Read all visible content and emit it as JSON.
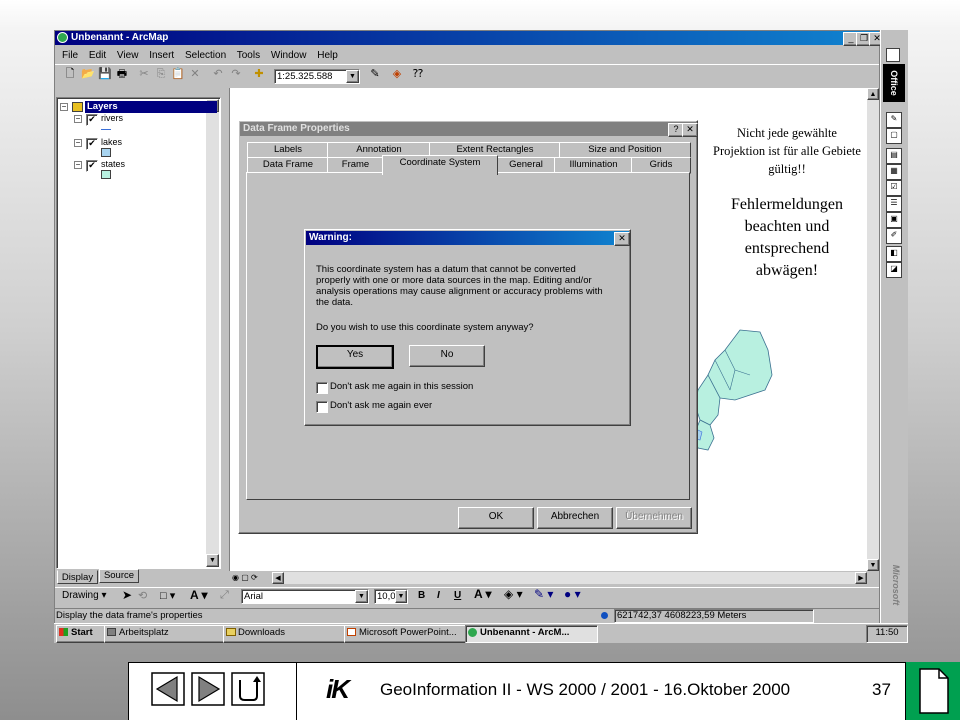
{
  "app": {
    "title": "Unbenannt - ArcMap",
    "menu": [
      "File",
      "Edit",
      "View",
      "Insert",
      "Selection",
      "Tools",
      "Window",
      "Help"
    ],
    "scale": "1:25.325.588"
  },
  "toc": {
    "root": "Layers",
    "layers": [
      {
        "name": "rivers",
        "symbol": "line",
        "color": "#3a6fd8"
      },
      {
        "name": "lakes",
        "symbol": "fill",
        "color": "#a8d4f0"
      },
      {
        "name": "states",
        "symbol": "fill",
        "color": "#b8f0e0"
      }
    ],
    "tabs": [
      "Display",
      "Source"
    ]
  },
  "dialog": {
    "title": "Data Frame Properties",
    "tabs_back": [
      "Labels",
      "Annotation",
      "Extent Rectangles",
      "Size and Position"
    ],
    "tabs_front": [
      "Data Frame",
      "Frame",
      "Coordinate System",
      "General",
      "Illumination",
      "Grids"
    ],
    "active_tab": "Coordinate System",
    "buttons": {
      "ok": "OK",
      "cancel": "Abbrechen",
      "apply": "Übernehmen"
    }
  },
  "warning": {
    "title": "Warning:",
    "message": "This coordinate system has a datum that cannot be converted properly with one or more data sources in the map. Editing and/or analysis operations may cause alignment or accuracy problems with the data.",
    "question": "Do you wish to use this coordinate system anyway?",
    "yes": "Yes",
    "no": "No",
    "check1": "Don't ask me again in this session",
    "check2": "Don't ask me again ever"
  },
  "annotation": {
    "line1": "Nicht jede gewählte Projektion ist für alle Gebiete gültig!!",
    "line2": "Fehlermeldungen beachten und entsprechend abwägen!"
  },
  "drawing": {
    "label": "Drawing",
    "font": "Arial",
    "size": "10,0",
    "bold": "B",
    "italic": "I",
    "underline": "U"
  },
  "status": {
    "text": "Display the data frame's properties",
    "coords": "621742,37  4608223,59 Meters"
  },
  "taskbar": {
    "start": "Start",
    "items": [
      "Arbeitsplatz",
      "Downloads",
      "Microsoft PowerPoint...",
      "Unbenannt - ArcM..."
    ],
    "clock": "11:50"
  },
  "office": {
    "label": "Office",
    "brand": "Microsoft"
  },
  "footer": {
    "logo": "iK",
    "text": "GeoInformation II - WS 2000 / 2001 - 16.Oktober 2000",
    "page": "37"
  },
  "colors": {
    "titlebar": "#000080",
    "footer_green": "#00a050",
    "state_fill": "#b8f0e0"
  }
}
